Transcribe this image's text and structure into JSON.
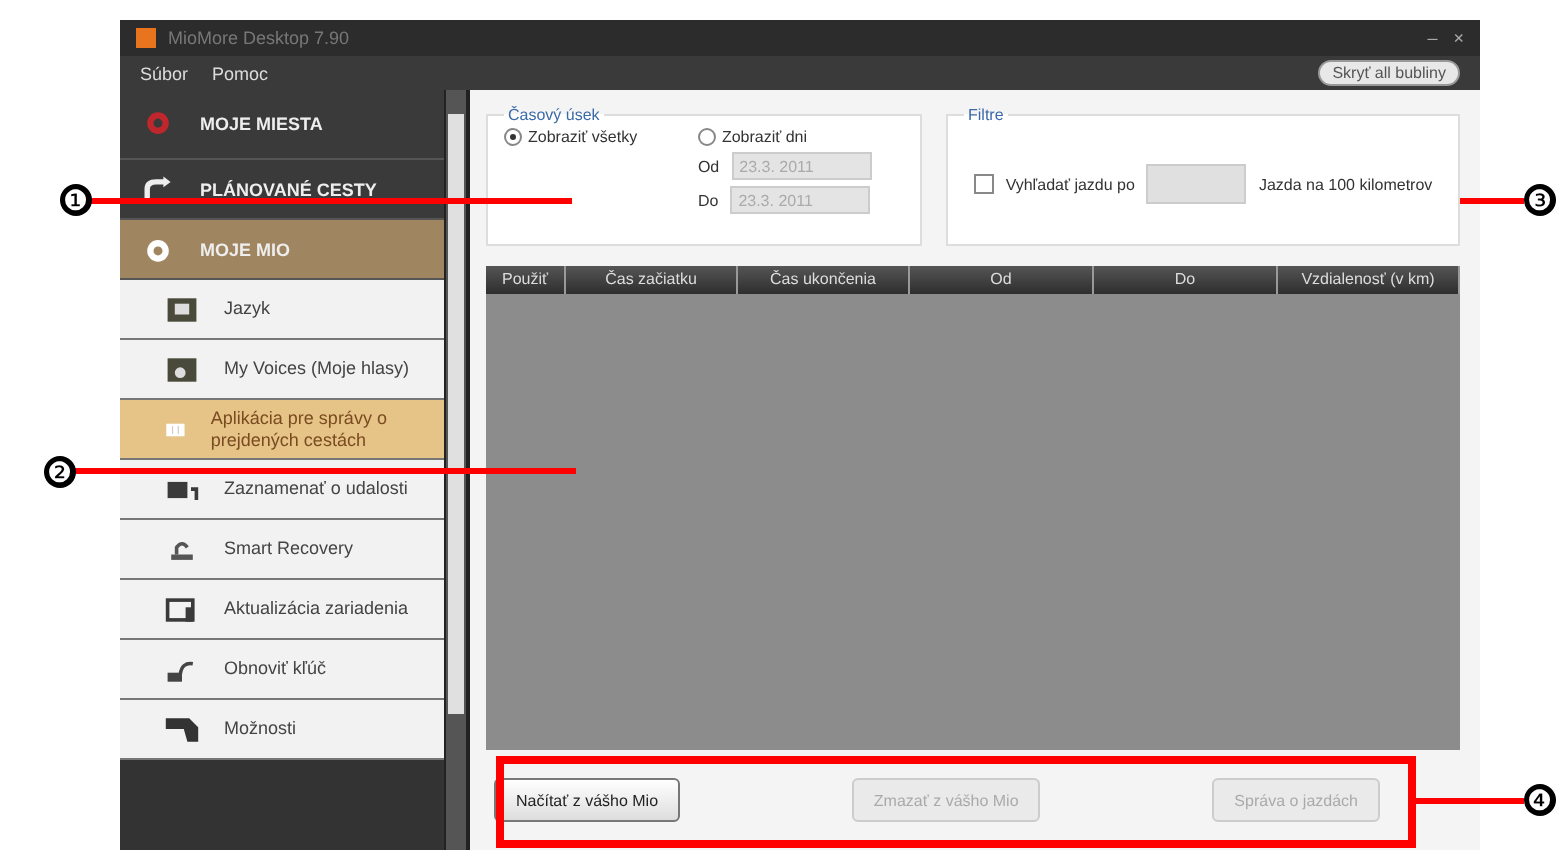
{
  "window": {
    "title": "MioMore Desktop 7.90",
    "controls": [
      "–",
      "×"
    ]
  },
  "menu": [
    "Súbor",
    "Pomoc"
  ],
  "hide_bubbles_button": "Skryť all bubliny",
  "sidebar": {
    "items": [
      {
        "kind": "section",
        "label": "MOJE MIESTA",
        "selected": false
      },
      {
        "kind": "section",
        "label": "PLÁNOVANÉ CESTY",
        "selected": false
      },
      {
        "kind": "section",
        "label": "MOJE MIO",
        "selected": true
      },
      {
        "kind": "item",
        "label": "Jazyk",
        "selected": false
      },
      {
        "kind": "item",
        "label": "My Voices (Moje hlasy)",
        "selected": false
      },
      {
        "kind": "item",
        "label": "Aplikácia pre správy o prejdených cestách",
        "selected": true
      },
      {
        "kind": "item",
        "label": "Zaznamenať o udalosti",
        "selected": false
      },
      {
        "kind": "item",
        "label": "Smart Recovery",
        "selected": false
      },
      {
        "kind": "item",
        "label": "Aktualizácia zariadenia",
        "selected": false
      },
      {
        "kind": "item",
        "label": "Obnoviť kľúč",
        "selected": false
      },
      {
        "kind": "item",
        "label": "Možnosti",
        "selected": false
      }
    ]
  },
  "time_group": {
    "title": "Časový úsek",
    "options": [
      {
        "label": "Zobraziť všetky",
        "selected": true
      },
      {
        "label": "Zobraziť dni",
        "selected": false
      }
    ],
    "fields": [
      {
        "label": "Od",
        "value": "23.3. 2011",
        "disabled": true
      },
      {
        "label": "Do",
        "value": "23.3. 2011",
        "disabled": true
      }
    ]
  },
  "filter_group": {
    "title": "Filtre",
    "checkbox": {
      "label": "Vyhľadať jazdu po",
      "checked": false
    },
    "suffix": "Jazda na 100 kilometrov"
  },
  "table": {
    "columns": [
      "Použiť",
      "Čas začiatku",
      "Čas ukončenia",
      "Od",
      "Do",
      "Vzdialenosť (v km)"
    ]
  },
  "buttons": [
    {
      "label": "Načítať z vášho Mio",
      "disabled": false
    },
    {
      "label": "Zmazať z vášho Mio",
      "disabled": true
    },
    {
      "label": "Správa o jazdách",
      "disabled": true
    }
  ],
  "annotations": [
    {
      "label": "❶"
    },
    {
      "label": "❷"
    },
    {
      "label": "❸"
    },
    {
      "label": "❹"
    }
  ]
}
